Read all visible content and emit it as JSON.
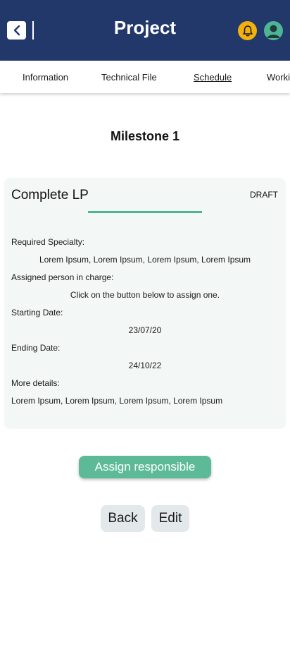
{
  "header": {
    "title": "Project",
    "back_icon": "chevron-left-icon",
    "bell_icon": "bell-icon",
    "avatar_icon": "user-avatar-icon",
    "bar_color": "#22386b",
    "bell_color": "#f2b10d",
    "avatar_color": "#4db596"
  },
  "tabs": [
    {
      "label": "Information",
      "active": false
    },
    {
      "label": "Technical File",
      "active": false
    },
    {
      "label": "Schedule",
      "active": true
    },
    {
      "label": "Worki",
      "active": false
    }
  ],
  "milestone": {
    "title": "Milestone 1"
  },
  "card": {
    "title": "Complete LP",
    "status": "DRAFT",
    "accent_color": "#4db596",
    "required_specialty_label": "Required Specialty:",
    "required_specialty_value": "Lorem Ipsum, Lorem Ipsum, Lorem Ipsum, Lorem Ipsum",
    "assigned_label": "Assigned person in charge:",
    "assigned_value": "Click on the button below to assign one.",
    "start_label": "Starting Date:",
    "start_value": "23/07/20",
    "end_label": "Ending Date:",
    "end_value": "24/10/22",
    "details_label": "More details:",
    "details_value": "Lorem Ipsum, Lorem Ipsum, Lorem Ipsum, Lorem Ipsum"
  },
  "actions": {
    "assign_label": "Assign responsible",
    "back_label": "Back",
    "edit_label": "Edit",
    "assign_color": "#5cba98"
  }
}
